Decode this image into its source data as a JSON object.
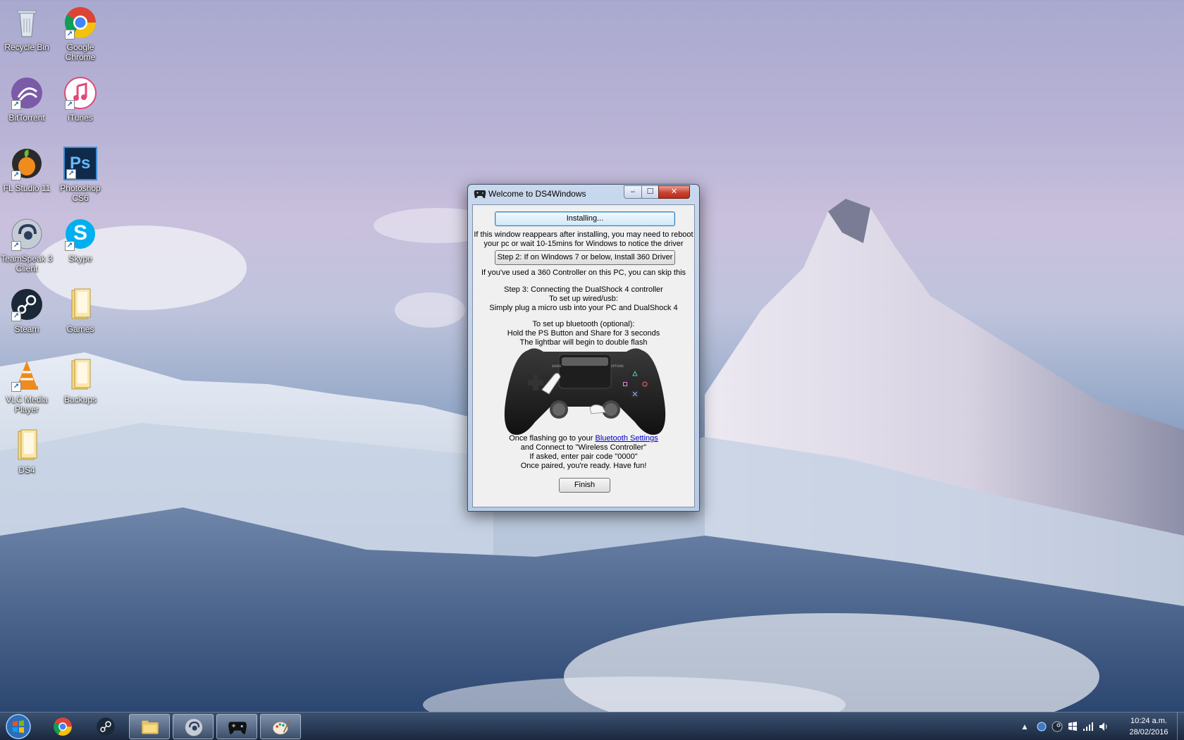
{
  "desktop": {
    "icons": [
      {
        "label": "Recycle Bin",
        "icon": "recycle-bin-icon"
      },
      {
        "label": "Google Chrome",
        "icon": "chrome-icon"
      },
      {
        "label": "BitTorrent",
        "icon": "bittorrent-icon"
      },
      {
        "label": "iTunes",
        "icon": "itunes-icon"
      },
      {
        "label": "FL Studio 11",
        "icon": "fl-studio-icon"
      },
      {
        "label": "Photoshop CS6",
        "icon": "photoshop-icon",
        "glyph": "Ps"
      },
      {
        "label": "TeamSpeak 3 Client",
        "icon": "teamspeak-icon"
      },
      {
        "label": "Skype",
        "icon": "skype-icon",
        "glyph": "S"
      },
      {
        "label": "Steam",
        "icon": "steam-icon"
      },
      {
        "label": "Games",
        "icon": "folder-icon"
      },
      {
        "label": "VLC Media Player",
        "icon": "vlc-icon"
      },
      {
        "label": "Backups",
        "icon": "folder-icon"
      },
      {
        "label": "DS4",
        "icon": "folder-icon"
      }
    ]
  },
  "dialog": {
    "title": "Welcome to DS4Windows",
    "min_glyph": "–",
    "max_glyph": "☐",
    "close_glyph": "✕",
    "installing_label": "Installing...",
    "reboot_note_1": "If this window reappears after installing, you may need to reboot",
    "reboot_note_2": "your pc or wait 10-15mins for Windows to notice the driver",
    "step2_label": "Step 2: If on Windows 7 or below, Install 360 Driver",
    "skip_note": "If you've used a 360 Controller on this PC, you can skip this",
    "step3_line1": "Step 3: Connecting the DualShock 4 controller",
    "step3_line2": "To set up wired/usb:",
    "step3_line3": "Simply plug a micro usb into your PC and DualShock 4",
    "bt_line1": "To set up bluetooth (optional):",
    "bt_line2": "Hold the PS Button and Share for 3 seconds",
    "bt_line3": "The lightbar will begin to double flash",
    "gamepad_share": "SHARE",
    "gamepad_options": "OPTIONS",
    "flash_prefix": "Once flashing go to your ",
    "bt_settings_link": "Bluetooth Settings",
    "connect_line": "and Connect to \"Wireless Controller\"",
    "pair_line": "If asked, enter pair code \"0000\"",
    "ready_line": "Once paired, you're ready. Have fun!",
    "finish_label": "Finish"
  },
  "taskbar": {
    "items": [
      {
        "name": "chrome",
        "icon": "chrome-icon",
        "active": false
      },
      {
        "name": "steam",
        "icon": "steam-icon",
        "active": false
      },
      {
        "name": "file-explorer",
        "icon": "folder-icon",
        "active": true
      },
      {
        "name": "teamspeak",
        "icon": "teamspeak-icon",
        "active": true
      },
      {
        "name": "ds4windows",
        "icon": "gamepad-icon",
        "active": true
      },
      {
        "name": "paint",
        "icon": "paint-icon",
        "active": true
      }
    ],
    "tray": {
      "time": "10:24 a.m.",
      "date": "28/02/2016"
    }
  },
  "colors": {
    "link": "#0000cc",
    "close_button": "#c9412f"
  }
}
